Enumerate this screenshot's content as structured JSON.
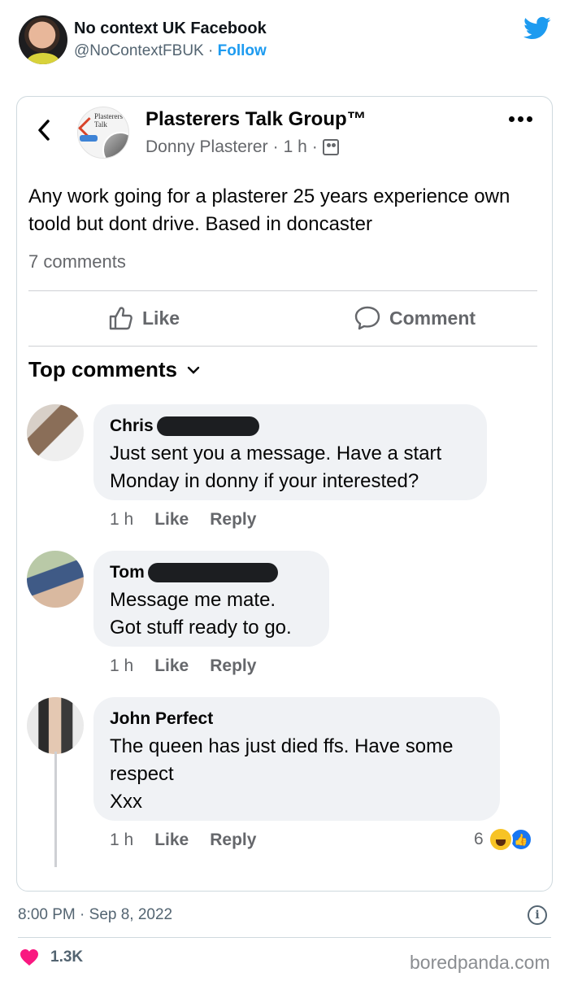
{
  "tweet": {
    "author_name": "No context UK Facebook",
    "author_handle": "@NoContextFBUK",
    "separator": "·",
    "follow_label": "Follow",
    "brand_icon": "twitter-bird-icon",
    "accent_color": "#1d9bf0",
    "timestamp": "8:00 PM · Sep 8, 2022",
    "like_count": "1.3K",
    "heart_color": "#f91880"
  },
  "post": {
    "group_name": "Plasterers Talk Group™",
    "author": "Donny Plasterer",
    "time": "1 h",
    "separator": "·",
    "logo_text": "Plasterers Talk",
    "text": "Any work going for a plasterer 25 years experience own toold but dont drive. Based in doncaster",
    "comment_count": "7 comments",
    "like_label": "Like",
    "comment_label": "Comment",
    "top_comments_label": "Top comments"
  },
  "comments": [
    {
      "name": "Chris",
      "text": "Just sent you a message. Have a start\nMonday in donny if your interested?",
      "time": "1 h",
      "like": "Like",
      "reply": "Reply"
    },
    {
      "name": "Tom",
      "text": "Message me mate.\nGot stuff ready to go.",
      "time": "1 h",
      "like": "Like",
      "reply": "Reply"
    },
    {
      "name": "John Perfect",
      "text": "The queen has just died ffs. Have some\nrespect\nXxx",
      "time": "1 h",
      "like": "Like",
      "reply": "Reply",
      "reaction_count": "6",
      "reactions": [
        "haha-reaction-icon",
        "like-reaction-icon"
      ]
    }
  ],
  "watermark": "boredpanda.com"
}
